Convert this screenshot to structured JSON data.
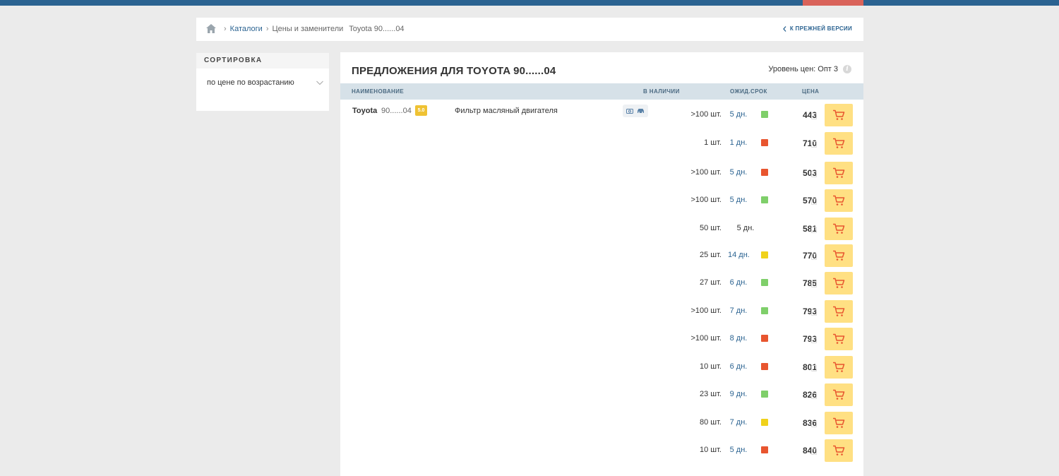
{
  "colors": {
    "top_bar": "#2b6391",
    "top_bar_accent": "#d9635a",
    "status_green": "#7fcf6a",
    "status_red": "#e8552f",
    "status_yellow": "#f0d21b",
    "cart_button": "#ffe083",
    "rating_badge": "#efc233"
  },
  "breadcrumb": {
    "home_icon": "home-icon",
    "items": [
      "Каталоги",
      "Цены и заменители",
      "Toyota 90......04"
    ],
    "back_link": "К ПРЕЖНЕЙ ВЕРСИИ"
  },
  "sort": {
    "title": "СОРТИРОВКА",
    "selected": "по цене по возрастанию"
  },
  "main": {
    "title": "ПРЕДЛОЖЕНИЯ ДЛЯ TOYOTA 90......04",
    "price_level": "Уровень цен: Опт 3",
    "info_icon": "i",
    "columns": {
      "name": "НАИМЕНОВАНИЕ",
      "in_stock": "В НАЛИЧИИ",
      "expected": "ОЖИД.СРОК",
      "price": "ЦЕНА"
    },
    "product": {
      "brand": "Toyota",
      "article": "90......04",
      "rating": "5.0",
      "description": "Фильтр масляный двигателя"
    },
    "offers": [
      {
        "qty": ">100 шт.",
        "days": "5 дн.",
        "status": "green",
        "price": "443"
      },
      {
        "qty": "1 шт.",
        "days": "1 дн.",
        "status": "red",
        "price": "710"
      },
      {
        "qty": ">100 шт.",
        "days": "5 дн.",
        "status": "red",
        "price": "503"
      },
      {
        "qty": ">100 шт.",
        "days": "5 дн.",
        "status": "green",
        "price": "570"
      },
      {
        "qty": "50 шт.",
        "days": "5 дн.",
        "status": "none",
        "price": "581"
      },
      {
        "qty": "25 шт.",
        "days": "14 дн.",
        "status": "yellow",
        "price": "770"
      },
      {
        "qty": "27 шт.",
        "days": "6 дн.",
        "status": "green",
        "price": "785"
      },
      {
        "qty": ">100 шт.",
        "days": "7 дн.",
        "status": "green",
        "price": "793"
      },
      {
        "qty": ">100 шт.",
        "days": "8 дн.",
        "status": "red",
        "price": "793"
      },
      {
        "qty": "10 шт.",
        "days": "6 дн.",
        "status": "red",
        "price": "801"
      },
      {
        "qty": "23 шт.",
        "days": "9 дн.",
        "status": "green",
        "price": "826"
      },
      {
        "qty": "80 шт.",
        "days": "7 дн.",
        "status": "yellow",
        "price": "836"
      },
      {
        "qty": "10 шт.",
        "days": "5 дн.",
        "status": "red",
        "price": "840"
      }
    ]
  }
}
